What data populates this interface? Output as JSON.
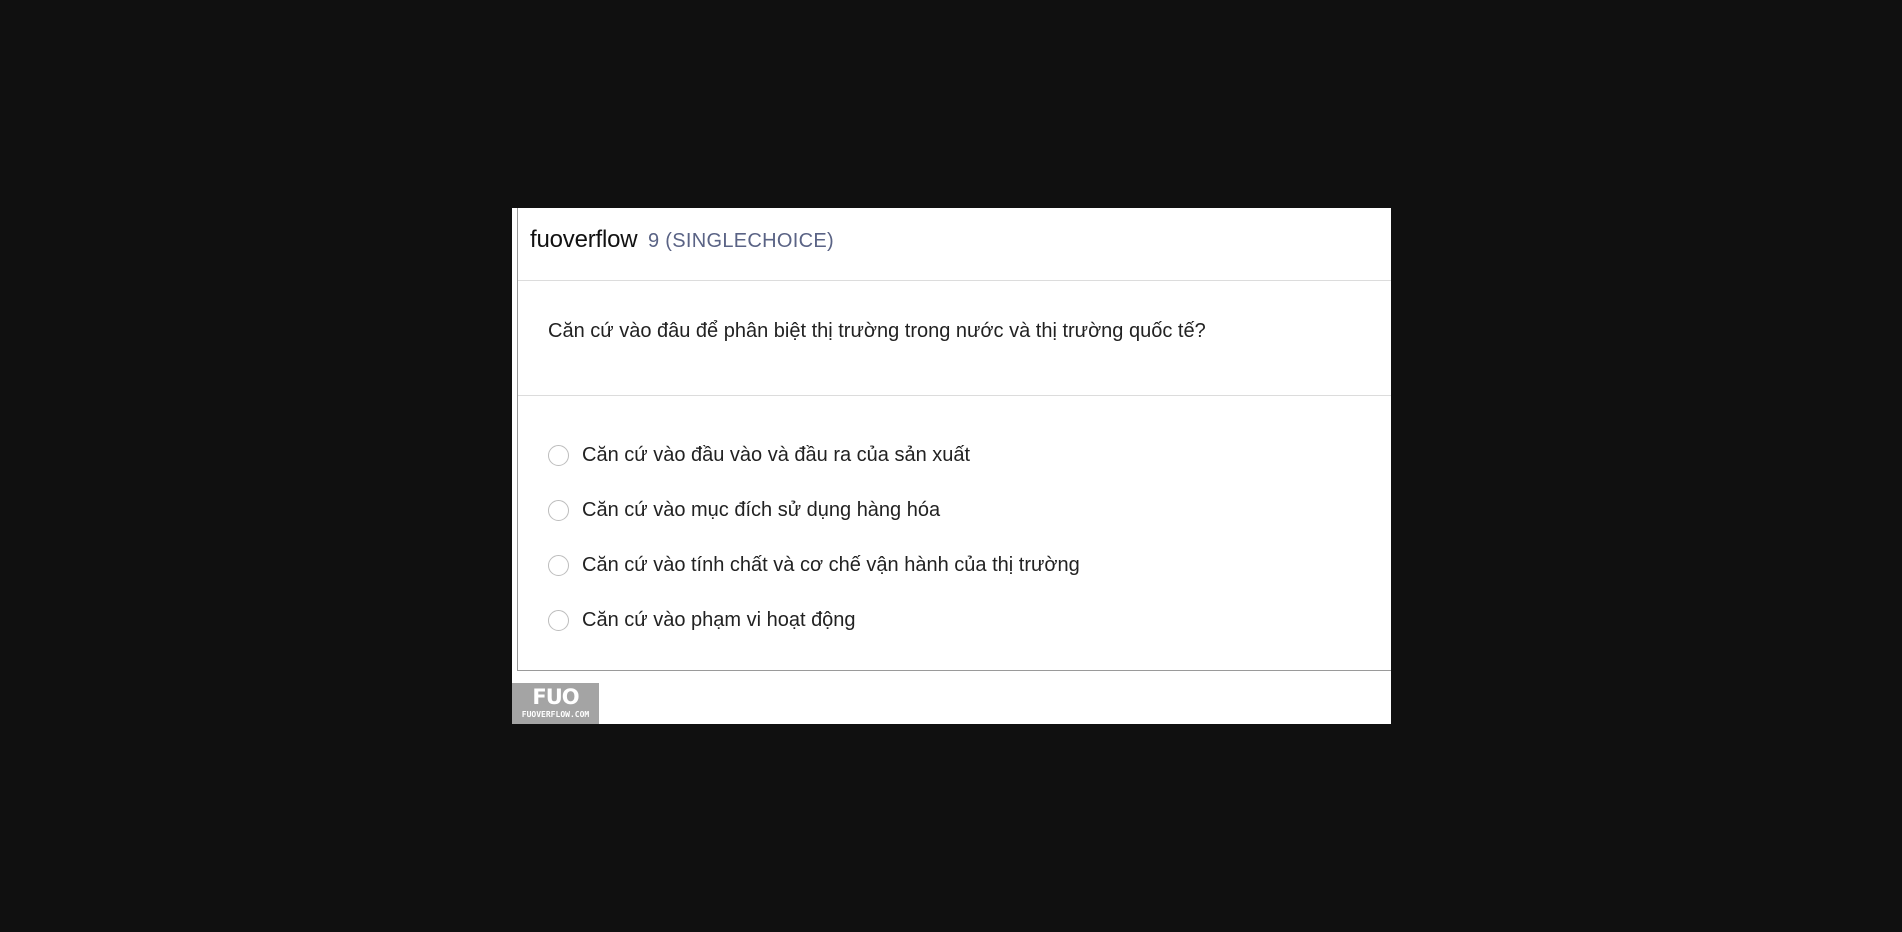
{
  "header": {
    "brand": "fuoverflow",
    "question_type": "9 (SINGLECHOICE)"
  },
  "question": {
    "text": "Căn cứ vào đâu để phân biệt thị trường trong nước và thị trường quốc tế?"
  },
  "options": [
    {
      "label": "Căn cứ vào đầu vào và đầu ra của sản xuất"
    },
    {
      "label": "Căn cứ vào mục đích sử dụng hàng hóa"
    },
    {
      "label": "Căn cứ vào tính chất và cơ chế vận hành của thị trường"
    },
    {
      "label": "Căn cứ vào phạm vi hoạt động"
    }
  ],
  "logo": {
    "mark": "FUO",
    "site": "FUOVERFLOW.COM"
  }
}
